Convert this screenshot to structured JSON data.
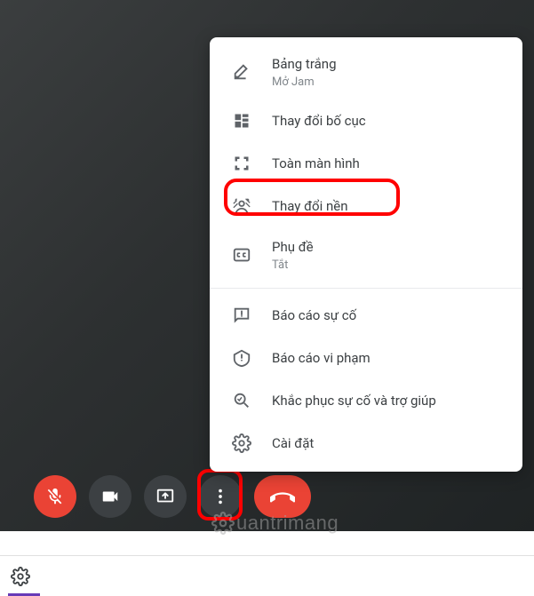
{
  "menu": {
    "whiteboard": {
      "label": "Bảng trắng",
      "sub": "Mở Jam"
    },
    "layout": {
      "label": "Thay đổi bố cục"
    },
    "fullscreen": {
      "label": "Toàn màn hình"
    },
    "background": {
      "label": "Thay đổi nền"
    },
    "captions": {
      "label": "Phụ đề",
      "sub": "Tắt"
    },
    "report": {
      "label": "Báo cáo sự cố"
    },
    "abuse": {
      "label": "Báo cáo vi phạm"
    },
    "help": {
      "label": "Khắc phục sự cố và trợ giúp"
    },
    "settings": {
      "label": "Cài đặt"
    }
  },
  "watermark_text": "uantrimang"
}
